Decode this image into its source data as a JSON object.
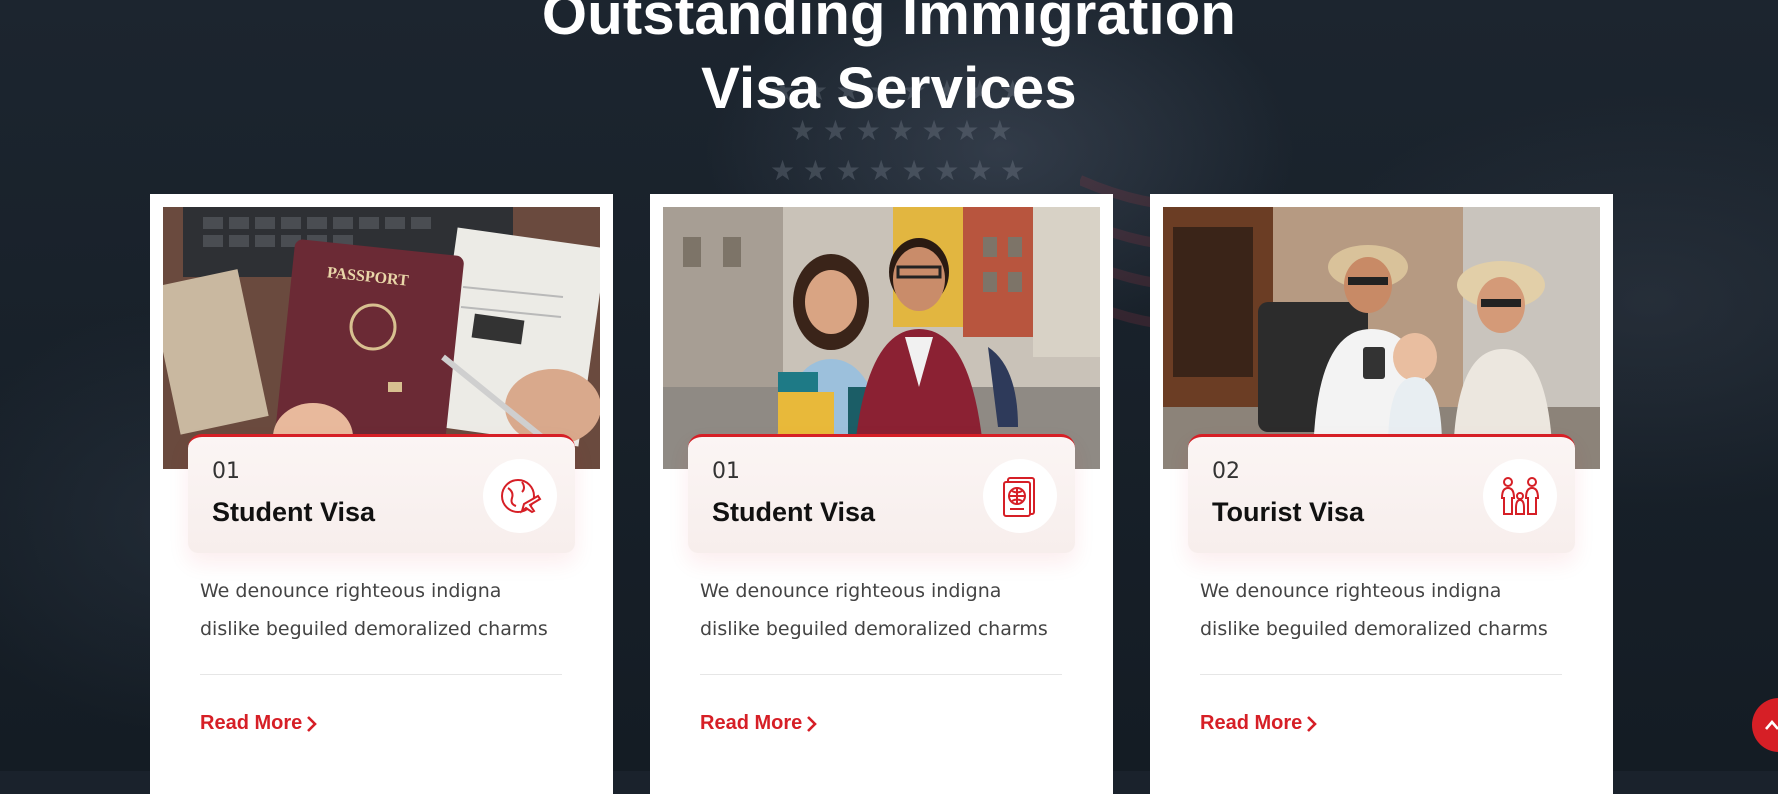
{
  "section": {
    "heading_line1": "Outstanding Immigration",
    "heading_line2": "Visa Services"
  },
  "cards": [
    {
      "number": "01",
      "title": "Student Visa",
      "description": "We denounce righteous indigna dislike beguiled demoralized charms",
      "link": "Read More",
      "icon": "globe-plane-icon",
      "photo": "passport-photo"
    },
    {
      "number": "01",
      "title": "Student Visa",
      "description": "We denounce righteous indigna dislike beguiled demoralized charms",
      "link": "Read More",
      "icon": "passport-icon",
      "photo": "students-photo"
    },
    {
      "number": "02",
      "title": "Tourist Visa",
      "description": "We denounce righteous indigna dislike beguiled demoralized charms",
      "link": "Read More",
      "icon": "family-icon",
      "photo": "tourist-family-photo"
    }
  ],
  "colors": {
    "accent": "#d61f26",
    "background": "#1a222c"
  },
  "passport_text": "PASSPORT"
}
